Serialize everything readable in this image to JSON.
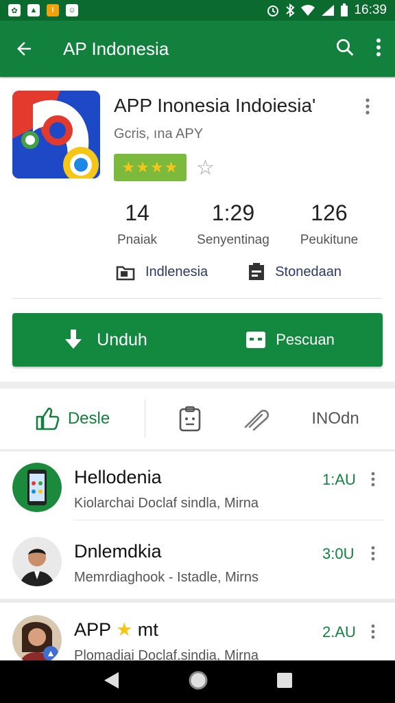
{
  "status_bar": {
    "time": "16:39"
  },
  "app_bar": {
    "title": "AP Indonesia"
  },
  "app": {
    "title": "APP Inonesia Indoiesia'",
    "developer": "Gcris, ına APY",
    "rating_stars": "★★★★",
    "empty_star": "☆",
    "stats": [
      {
        "value": "14",
        "label": "Pnaiak"
      },
      {
        "value": "1:29",
        "label": "Senyentinag"
      },
      {
        "value": "126",
        "label": "Peukitune"
      }
    ],
    "meta": [
      {
        "label": "Indlenesia",
        "icon": "folder-tag-icon"
      },
      {
        "label": "Stonedaan",
        "icon": "clipboard-icon"
      }
    ],
    "cta": {
      "install_label": "Unduh",
      "secondary_label": "Pescuan"
    }
  },
  "actions": {
    "like_label": "Desle",
    "wishlist_label": "INOdn"
  },
  "list": [
    {
      "title": "Hellodenia",
      "subtitle": "Kiolarchai Doclaf sindla, Mirna",
      "time": "1:AU"
    },
    {
      "title": "Dnlemdkia",
      "subtitle": "Memrdiaghook - Istadle, Mirns",
      "time": "3:0U"
    },
    {
      "title": "APP",
      "title_star": "★",
      "title_suffix": "mt",
      "subtitle": "Plomadiai Doclaf.sindia, Mirna",
      "time": "2.AU"
    }
  ],
  "colors": {
    "primary": "#12813e",
    "status_bar": "#0b6b2f",
    "rating_badge": "#7cba3d",
    "star": "#f5c518"
  }
}
